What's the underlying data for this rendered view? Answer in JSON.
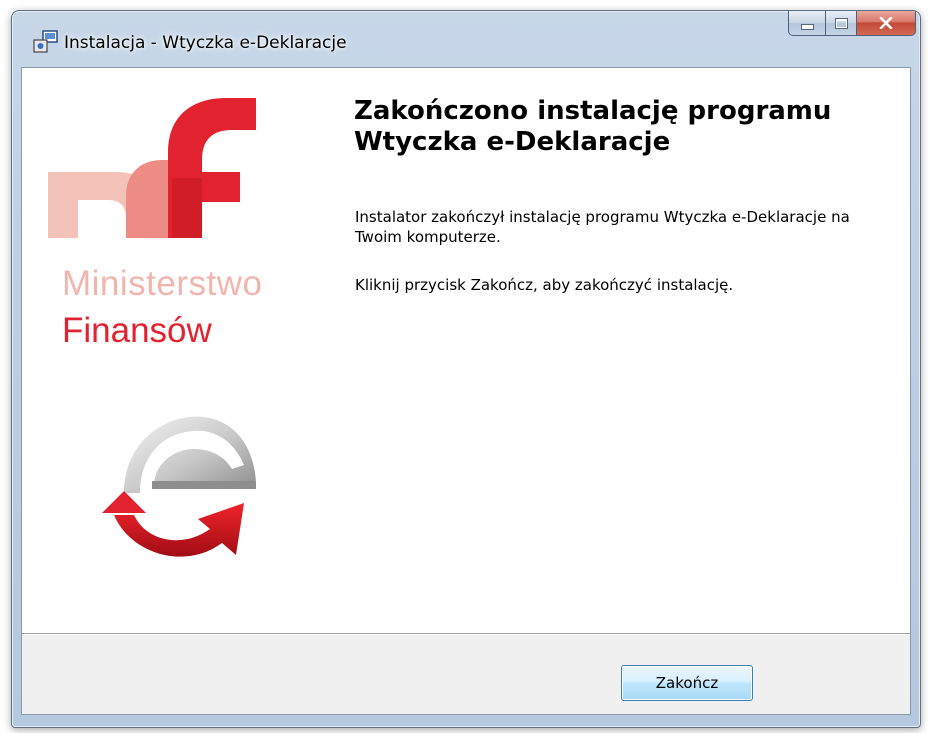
{
  "window": {
    "title": "Instalacja - Wtyczka e-Deklaracje",
    "title_icon": "installer-icon",
    "caption_buttons": [
      "minimize",
      "maximize",
      "close"
    ]
  },
  "sidebar": {
    "logo_line1": "Ministerstwo",
    "logo_line2": "Finansów",
    "logo_colors": {
      "light": "#f2b5ad",
      "brand_red": "#e2232f"
    }
  },
  "main": {
    "heading": "Zakończono instalację programu Wtyczka e-Deklaracje",
    "paragraph1": "Instalator zakończył instalację programu Wtyczka e-Deklaracje na Twoim komputerze.",
    "paragraph2": "Kliknij przycisk Zakończ, aby zakończyć instalację."
  },
  "footer": {
    "finish_label": "Zakończ"
  }
}
